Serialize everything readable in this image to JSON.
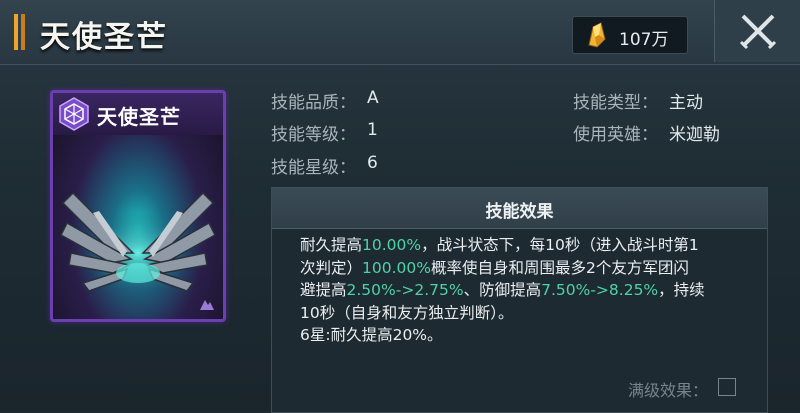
{
  "header": {
    "title": "天使圣芒",
    "currency_value": "107万"
  },
  "card": {
    "name": "天使圣芒",
    "rarity_color": "#6b3fb0",
    "emblem_icon": "hexagon-icon"
  },
  "info": [
    {
      "label": "技能品质：",
      "value": "A"
    },
    {
      "label": "技能等级：",
      "value": "1"
    },
    {
      "label": "技能星级：",
      "value": "6"
    },
    {
      "label": "技能类型：",
      "value": "主动"
    },
    {
      "label": "使用英雄：",
      "value": "米迦勒"
    }
  ],
  "effect": {
    "title": "技能效果",
    "highlight_color": "#4fd2a6",
    "line1": {
      "a": "耐久提高",
      "b": "10.00%",
      "c": "，战斗状态下，每10秒（进入战斗时第1"
    },
    "line2": {
      "a": "次判定）",
      "b": "100.00%",
      "c": "概率使自身和周围最多2个友方军团闪"
    },
    "line3": {
      "a": "避提高",
      "b": "2.50%->2.75%",
      "c": "、防御提高",
      "d": "7.50%->8.25%",
      "e": "，持续"
    },
    "line4": "10秒（自身和友方独立判断）。",
    "line5": "6星:耐久提高20%。",
    "max_label": "满级效果："
  }
}
